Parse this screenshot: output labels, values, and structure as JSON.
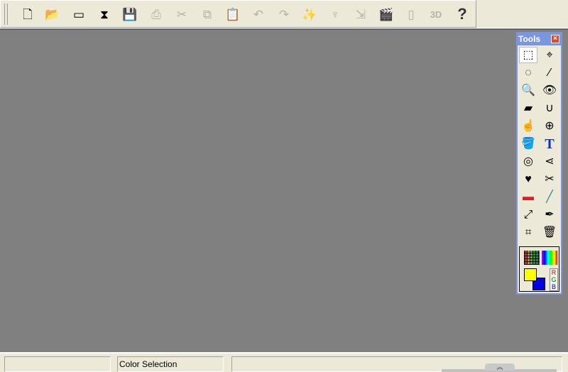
{
  "toolbar": {
    "items": [
      {
        "name": "new-icon",
        "glyph": "🗋",
        "enabled": true
      },
      {
        "name": "open-folder-icon",
        "glyph": "📂",
        "enabled": true
      },
      {
        "name": "album-icon",
        "glyph": "▭",
        "enabled": true
      },
      {
        "name": "scanner-icon",
        "glyph": "⧗",
        "enabled": true
      },
      {
        "name": "save-icon",
        "glyph": "💾",
        "enabled": false
      },
      {
        "name": "print-icon",
        "glyph": "⎙",
        "enabled": false
      },
      {
        "name": "cut-icon",
        "glyph": "✂",
        "enabled": false
      },
      {
        "name": "copy-icon",
        "glyph": "⧉",
        "enabled": false
      },
      {
        "name": "paste-icon",
        "glyph": "📋",
        "enabled": false
      },
      {
        "name": "undo-icon",
        "glyph": "↶",
        "enabled": false
      },
      {
        "name": "redo-icon",
        "glyph": "↷",
        "enabled": false
      },
      {
        "name": "magic-wand-icon",
        "glyph": "✨",
        "enabled": false
      },
      {
        "name": "effects-icon",
        "glyph": "♆",
        "enabled": false
      },
      {
        "name": "resize-icon",
        "glyph": "⇲",
        "enabled": false
      },
      {
        "name": "animation-icon",
        "glyph": "🎬",
        "enabled": false
      },
      {
        "name": "device-icon",
        "glyph": "▯",
        "enabled": false
      },
      {
        "name": "3d-icon",
        "glyph": "3D",
        "enabled": false
      },
      {
        "name": "help-icon",
        "glyph": "?",
        "enabled": true
      }
    ]
  },
  "tools": {
    "title": "Tools",
    "close": "×",
    "items": [
      {
        "name": "rect-select-tool-icon",
        "glyph": "⬚"
      },
      {
        "name": "move-select-tool-icon",
        "glyph": "⌖"
      },
      {
        "name": "lasso-tool-icon",
        "glyph": "◌"
      },
      {
        "name": "magic-wand-tool-icon",
        "glyph": "⁄"
      },
      {
        "name": "zoom-tool-icon",
        "glyph": "🔍"
      },
      {
        "name": "red-eye-tool-icon",
        "glyph": "👁"
      },
      {
        "name": "eraser-tool-icon",
        "glyph": "▰"
      },
      {
        "name": "magnet-eraser-tool-icon",
        "glyph": "∪"
      },
      {
        "name": "smudge-tool-icon",
        "glyph": "☝"
      },
      {
        "name": "clone-tool-icon",
        "glyph": "⊕"
      },
      {
        "name": "paint-bucket-tool-icon",
        "glyph": "🪣"
      },
      {
        "name": "text-tool-icon",
        "glyph": "T"
      },
      {
        "name": "light-tool-icon",
        "glyph": "◎"
      },
      {
        "name": "spotlight-tool-icon",
        "glyph": "⋖"
      },
      {
        "name": "stamp-tool-icon",
        "glyph": "♥"
      },
      {
        "name": "cutout-tool-icon",
        "glyph": "✂"
      },
      {
        "name": "gradient-tool-icon",
        "glyph": "▬"
      },
      {
        "name": "line-tool-icon",
        "glyph": "╱"
      },
      {
        "name": "transform-tool-icon",
        "glyph": "⤢"
      },
      {
        "name": "eyedropper-tool-icon",
        "glyph": "✒"
      },
      {
        "name": "crop-tool-icon",
        "glyph": "⌗"
      },
      {
        "name": "trash-tool-icon",
        "glyph": "🗑"
      }
    ]
  },
  "colors": {
    "foreground": "#ffff00",
    "background": "#0000e0",
    "rgb": [
      "R",
      "G",
      "B"
    ],
    "rgb_colors": [
      "#d00000",
      "#008000",
      "#0000d0"
    ]
  },
  "status": {
    "pane1": "",
    "pane2": "Color Selection",
    "pane3": "",
    "restore": "︽"
  }
}
